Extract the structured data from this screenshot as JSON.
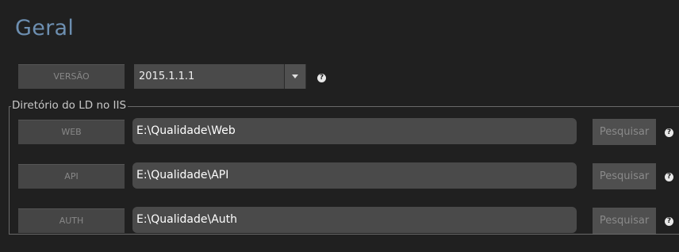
{
  "title": "Geral",
  "version": {
    "label": "VERSÃO",
    "value": "2015.1.1.1"
  },
  "directory_group": {
    "legend": "Diretório do LD no IIS",
    "rows": [
      {
        "label": "WEB",
        "path": "E:\\Qualidade\\Web",
        "button": "Pesquisar"
      },
      {
        "label": "API",
        "path": "E:\\Qualidade\\API",
        "button": "Pesquisar"
      },
      {
        "label": "AUTH",
        "path": "E:\\Qualidade\\Auth",
        "button": "Pesquisar"
      }
    ]
  },
  "help_symbol": "?",
  "colors": {
    "background": "#202020",
    "title": "#6d8fb1",
    "field": "#4a4a4a",
    "label_box": "#454545"
  }
}
